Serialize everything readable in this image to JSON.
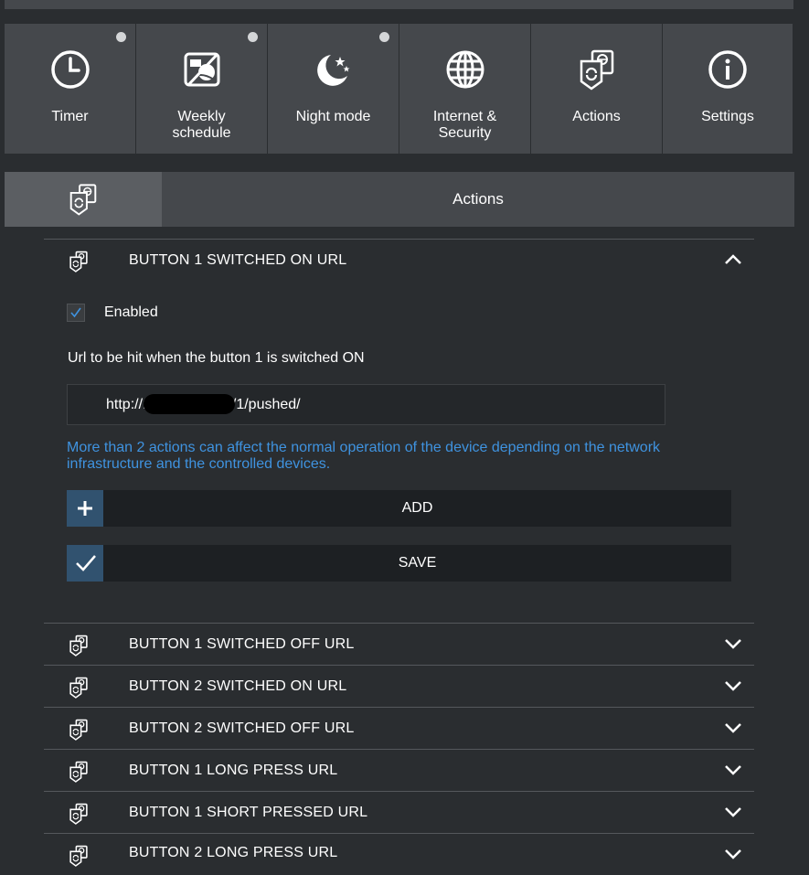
{
  "tiles": [
    {
      "label": "Timer",
      "icon": "clock-icon",
      "has_dot": true
    },
    {
      "label": "Weekly\nschedule",
      "icon": "calendar-weather-icon",
      "has_dot": true
    },
    {
      "label": "Night mode",
      "icon": "moon-stars-icon",
      "has_dot": true
    },
    {
      "label": "Internet &\nSecurity",
      "icon": "globe-icon",
      "has_dot": false
    },
    {
      "label": "Actions",
      "icon": "actions-icon",
      "has_dot": false
    },
    {
      "label": "Settings",
      "icon": "info-icon",
      "has_dot": false
    }
  ],
  "section": {
    "title": "Actions",
    "icon": "actions-icon"
  },
  "expanded": {
    "title": "BUTTON 1 SWITCHED ON URL",
    "enabled_label": "Enabled",
    "enabled": true,
    "url_label": "Url to be hit when the button 1 is switched ON",
    "url_value": "http://:39501/button/1/pushed/",
    "info": "More than 2 actions can affect the normal operation of the device depending on the network infrastructure and the controlled devices.",
    "add_label": "ADD",
    "save_label": "SAVE"
  },
  "collapsed": [
    "BUTTON 1 SWITCHED OFF URL",
    "BUTTON 2 SWITCHED ON URL",
    "BUTTON 2 SWITCHED OFF URL",
    "BUTTON 1 LONG PRESS URL",
    "BUTTON 1 SHORT PRESSED URL",
    "BUTTON 2 LONG PRESS URL"
  ],
  "colors": {
    "accent": "#3f93e0",
    "button_icon_bg": "#31526f",
    "tile_bg": "#45484c",
    "page_bg": "#2a2d30"
  }
}
